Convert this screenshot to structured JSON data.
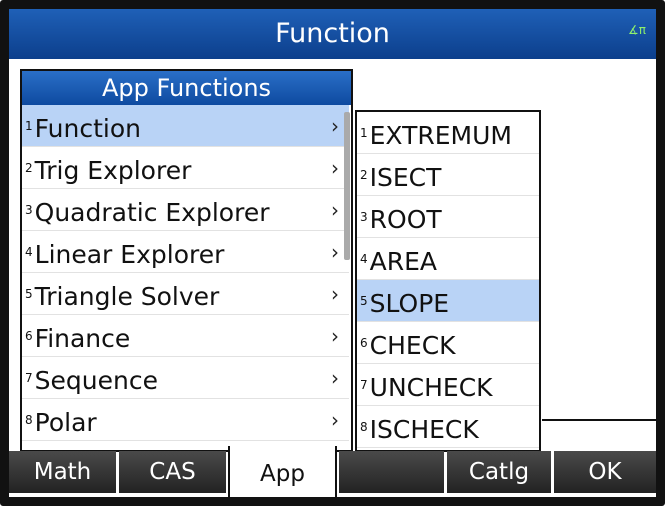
{
  "header": {
    "title": "Function",
    "angle_icon": "∡π"
  },
  "menu1": {
    "title": "App Functions",
    "items": [
      {
        "num": "1",
        "label": "Function"
      },
      {
        "num": "2",
        "label": "Trig Explorer"
      },
      {
        "num": "3",
        "label": "Quadratic Explorer"
      },
      {
        "num": "4",
        "label": "Linear Explorer"
      },
      {
        "num": "5",
        "label": "Triangle Solver"
      },
      {
        "num": "6",
        "label": "Finance"
      },
      {
        "num": "7",
        "label": "Sequence"
      },
      {
        "num": "8",
        "label": "Polar"
      }
    ],
    "chevron": "›"
  },
  "menu2": {
    "items": [
      {
        "num": "1",
        "label": "EXTREMUM"
      },
      {
        "num": "2",
        "label": "ISECT"
      },
      {
        "num": "3",
        "label": "ROOT"
      },
      {
        "num": "4",
        "label": "AREA"
      },
      {
        "num": "5",
        "label": "SLOPE"
      },
      {
        "num": "6",
        "label": "CHECK"
      },
      {
        "num": "7",
        "label": "UNCHECK"
      },
      {
        "num": "8",
        "label": "ISCHECK"
      }
    ]
  },
  "softkeys": [
    "Math",
    "CAS",
    "App",
    "",
    "Catlg",
    "OK"
  ]
}
